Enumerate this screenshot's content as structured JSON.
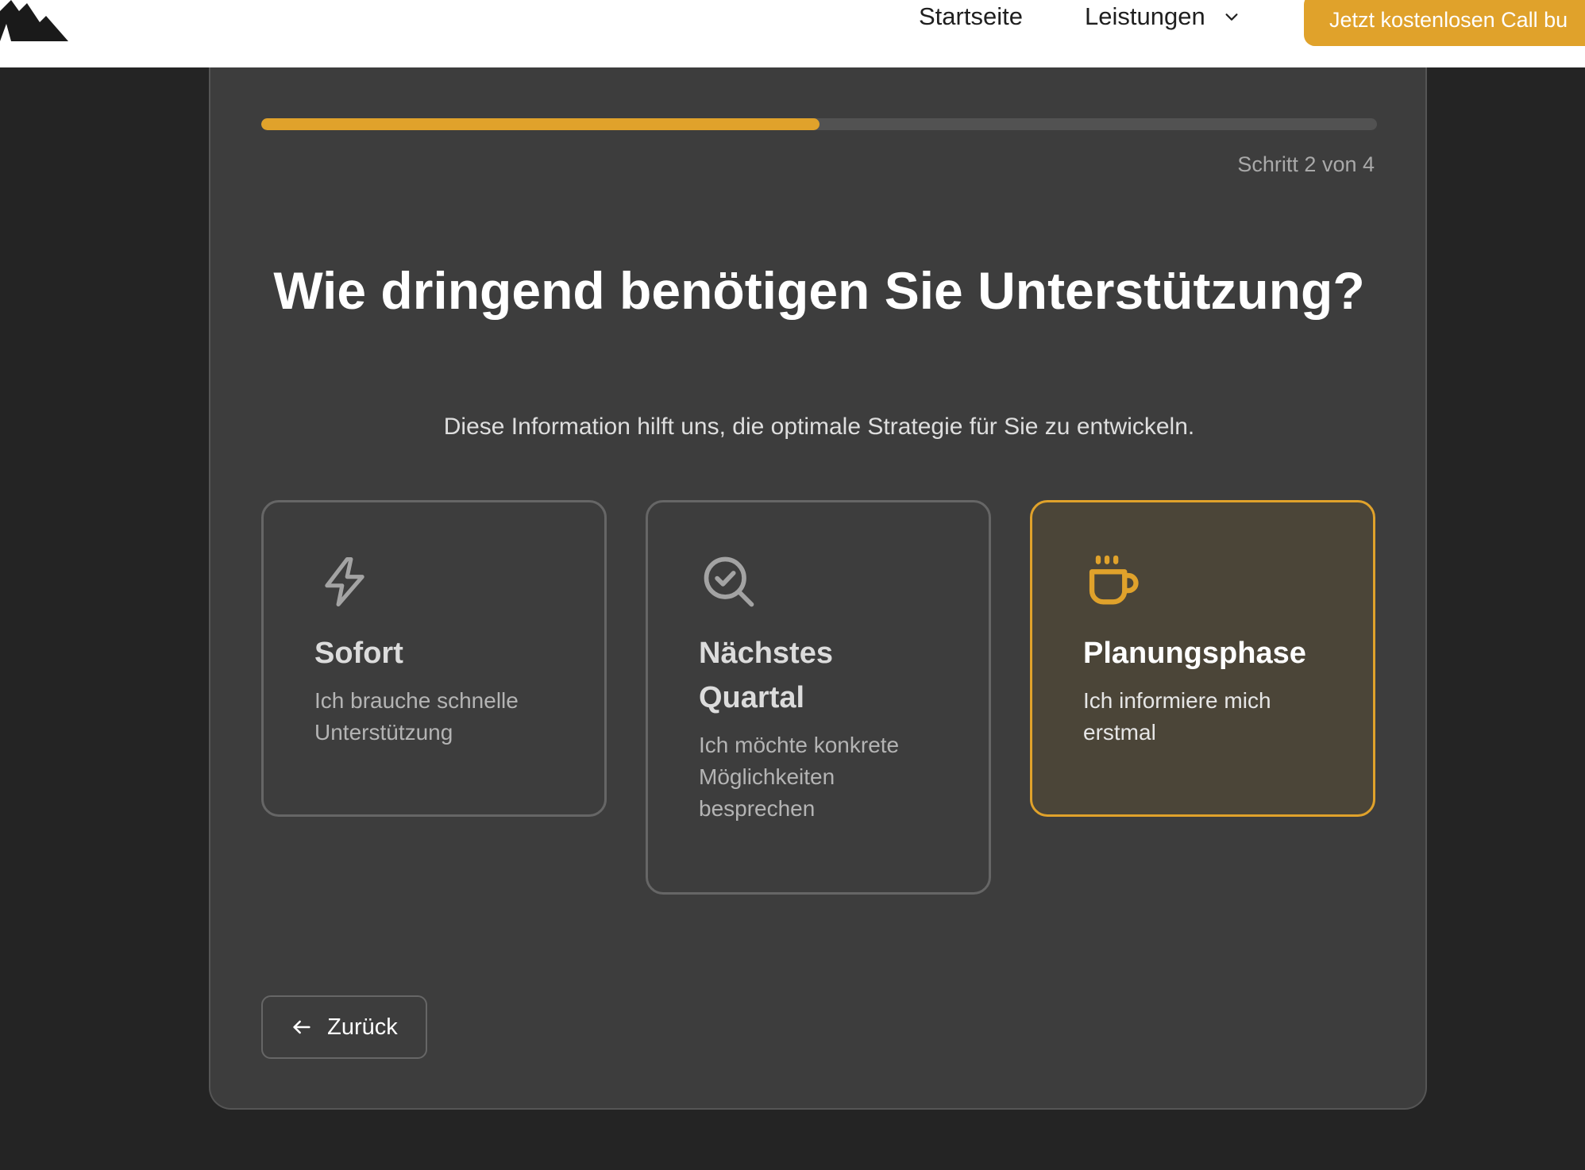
{
  "header": {
    "logo_icon": "mountain-logo-icon",
    "nav": {
      "home_label": "Startseite",
      "services_label": "Leistungen",
      "services_icon": "chevron-down-icon"
    },
    "cta_label": "Jetzt kostenlosen Call bu",
    "cta_color": "#e0a22b"
  },
  "wizard": {
    "progress": {
      "value": 0.5,
      "color": "#e0a22b"
    },
    "step_label": "Schritt 2 von 4",
    "question": {
      "title": "Wie dringend benötigen Sie Unterstützung?",
      "subtitle": "Diese Information hilft uns, die optimale Strategie für Sie zu entwickeln."
    },
    "options": [
      {
        "icon": "lightning-bolt-icon",
        "title": "Sofort",
        "description": "Ich brauche schnelle Unterstützung",
        "selected": false
      },
      {
        "icon": "search-check-icon",
        "title": "Nächstes Quartal",
        "description": "Ich möchte konkrete Möglichkeiten besprechen",
        "selected": false
      },
      {
        "icon": "coffee-cup-icon",
        "title": "Planungsphase",
        "description": "Ich informiere mich erstmal",
        "selected": true
      }
    ],
    "back": {
      "label": "Zurück",
      "icon": "arrow-left-icon"
    }
  }
}
